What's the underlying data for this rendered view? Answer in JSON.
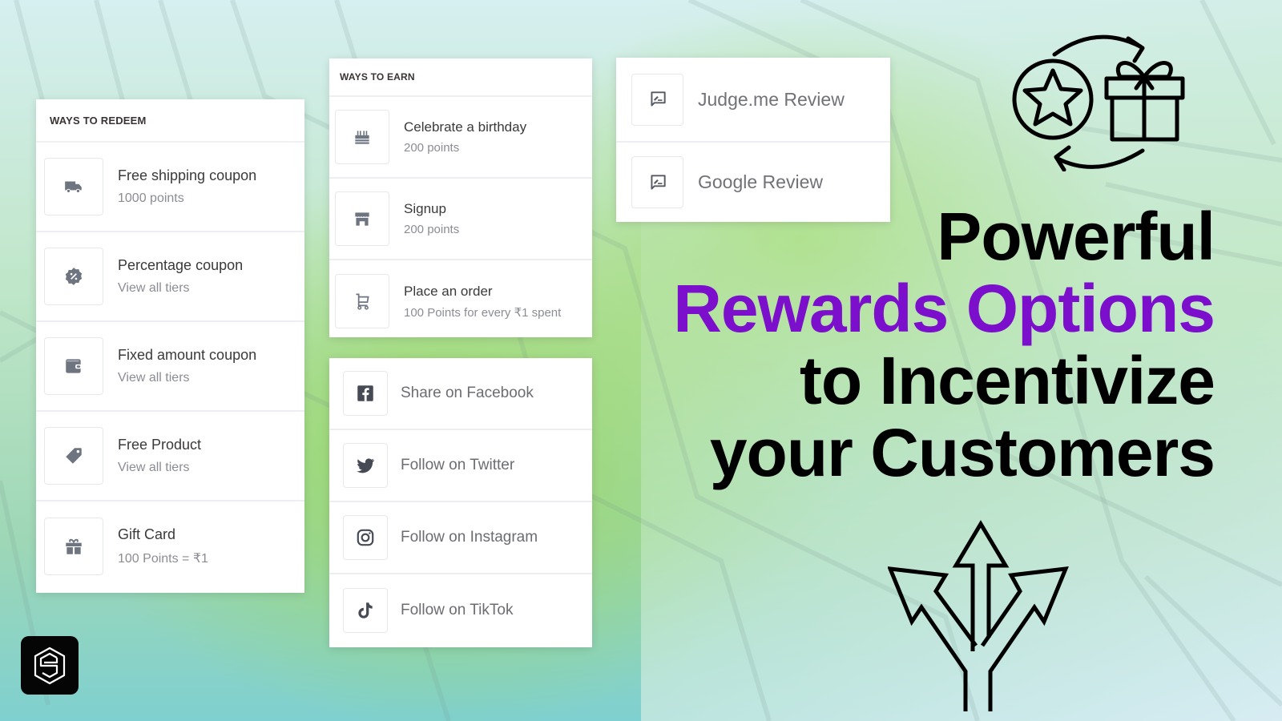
{
  "redeem": {
    "header": "WAYS TO REDEEM",
    "items": [
      {
        "icon": "truck-icon",
        "title": "Free shipping coupon",
        "subtitle": "1000 points"
      },
      {
        "icon": "percent-badge-icon",
        "title": "Percentage coupon",
        "subtitle": "View all tiers"
      },
      {
        "icon": "wallet-icon",
        "title": "Fixed amount coupon",
        "subtitle": "View all tiers"
      },
      {
        "icon": "tag-icon",
        "title": "Free Product",
        "subtitle": "View all tiers"
      },
      {
        "icon": "gift-icon",
        "title": "Gift Card",
        "subtitle": "100 Points = ₹1"
      }
    ]
  },
  "earn": {
    "header": "WAYS TO EARN",
    "items": [
      {
        "icon": "birthday-cake-icon",
        "title": "Celebrate a birthday",
        "subtitle": "200 points"
      },
      {
        "icon": "store-icon",
        "title": "Signup",
        "subtitle": "200 points"
      },
      {
        "icon": "cart-icon",
        "title": "Place an order",
        "subtitle": "100 Points for every ₹1 spent"
      }
    ]
  },
  "social": {
    "items": [
      {
        "icon": "facebook-icon",
        "label": "Share on Facebook"
      },
      {
        "icon": "twitter-icon",
        "label": "Follow on Twitter"
      },
      {
        "icon": "instagram-icon",
        "label": "Follow on Instagram"
      },
      {
        "icon": "tiktok-icon",
        "label": "Follow on TikTok"
      }
    ]
  },
  "reviews": {
    "items": [
      {
        "icon": "review-icon",
        "label": "Judge.me Review"
      },
      {
        "icon": "review-icon",
        "label": "Google Review"
      }
    ]
  },
  "headline": {
    "line1": "Powerful",
    "line2": "Rewards Options",
    "line3": "to Incentivize",
    "line4": "your Customers"
  },
  "colors": {
    "accent": "#7b0fcc",
    "icon_gray": "#6f7580",
    "headline": "#000000"
  }
}
